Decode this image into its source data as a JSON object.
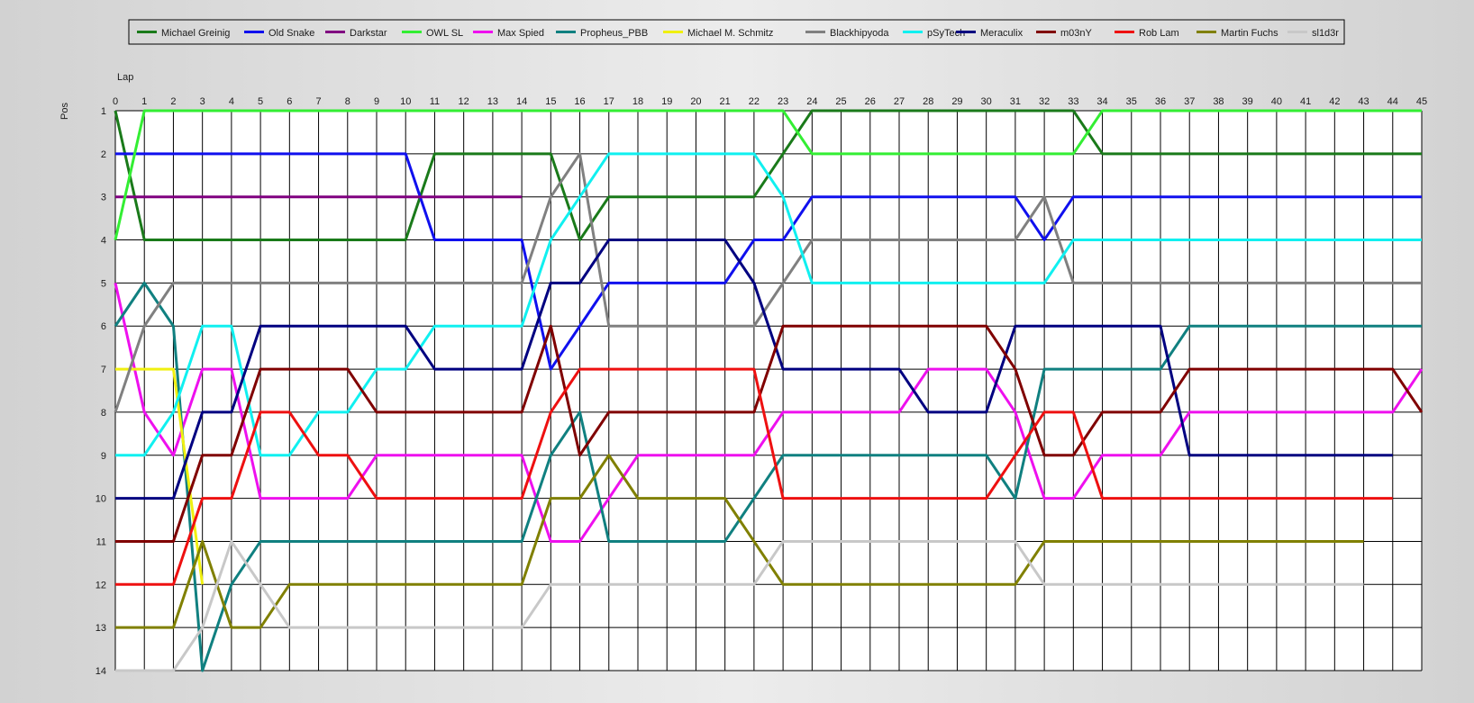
{
  "chart_data": {
    "type": "line",
    "xlabel": "Lap",
    "ylabel": "Pos",
    "xlim": [
      0,
      45
    ],
    "ylim": [
      1,
      14
    ],
    "y_inverted": true,
    "grid": true,
    "legend_position": "top",
    "x": [
      0,
      1,
      2,
      3,
      4,
      5,
      6,
      7,
      8,
      9,
      10,
      11,
      12,
      13,
      14,
      15,
      16,
      17,
      18,
      19,
      20,
      21,
      22,
      23,
      24,
      25,
      26,
      27,
      28,
      29,
      30,
      31,
      32,
      33,
      34,
      35,
      36,
      37,
      38,
      39,
      40,
      41,
      42,
      43,
      44,
      45
    ],
    "y_ticks": [
      1,
      2,
      3,
      4,
      5,
      6,
      7,
      8,
      9,
      10,
      11,
      12,
      13,
      14
    ],
    "series": [
      {
        "name": "Michael Greinig",
        "color": "#1a7a1a",
        "values": [
          1,
          4,
          4,
          4,
          4,
          4,
          4,
          4,
          4,
          4,
          4,
          2,
          2,
          2,
          2,
          2,
          4,
          3,
          3,
          3,
          3,
          3,
          3,
          2,
          1,
          1,
          1,
          1,
          1,
          1,
          1,
          1,
          1,
          1,
          2,
          2,
          2,
          2,
          2,
          2,
          2,
          2,
          2,
          2,
          2,
          2
        ]
      },
      {
        "name": "Old Snake",
        "color": "#1010ee",
        "values": [
          2,
          2,
          2,
          2,
          2,
          2,
          2,
          2,
          2,
          2,
          2,
          4,
          4,
          4,
          4,
          7,
          6,
          5,
          5,
          5,
          5,
          5,
          4,
          4,
          3,
          3,
          3,
          3,
          3,
          3,
          3,
          3,
          4,
          3,
          3,
          3,
          3,
          3,
          3,
          3,
          3,
          3,
          3,
          3,
          3,
          3
        ]
      },
      {
        "name": "Darkstar",
        "color": "#800080",
        "values": [
          3,
          3,
          3,
          3,
          3,
          3,
          3,
          3,
          3,
          3,
          3,
          3,
          3,
          3,
          3
        ]
      },
      {
        "name": "OWL SL",
        "color": "#33ee33",
        "values": [
          4,
          1,
          1,
          1,
          1,
          1,
          1,
          1,
          1,
          1,
          1,
          1,
          1,
          1,
          1,
          1,
          1,
          1,
          1,
          1,
          1,
          1,
          1,
          1,
          2,
          2,
          2,
          2,
          2,
          2,
          2,
          2,
          2,
          2,
          1,
          1,
          1,
          1,
          1,
          1,
          1,
          1,
          1,
          1,
          1,
          1
        ]
      },
      {
        "name": "Max Spied",
        "color": "#ee10ee",
        "values": [
          5,
          8,
          9,
          7,
          7,
          10,
          10,
          10,
          10,
          9,
          9,
          9,
          9,
          9,
          9,
          11,
          11,
          10,
          9,
          9,
          9,
          9,
          9,
          8,
          8,
          8,
          8,
          8,
          7,
          7,
          7,
          8,
          10,
          10,
          9,
          9,
          9,
          8,
          8,
          8,
          8,
          8,
          8,
          8,
          8,
          7
        ]
      },
      {
        "name": "Propheus_PBB",
        "color": "#108080",
        "values": [
          6,
          5,
          6,
          14,
          12,
          11,
          11,
          11,
          11,
          11,
          11,
          11,
          11,
          11,
          11,
          9,
          8,
          11,
          11,
          11,
          11,
          11,
          10,
          9,
          9,
          9,
          9,
          9,
          9,
          9,
          9,
          10,
          7,
          7,
          7,
          7,
          7,
          6,
          6,
          6,
          6,
          6,
          6,
          6,
          6,
          6
        ]
      },
      {
        "name": "Michael M. Schmitz",
        "color": "#f0f010",
        "values": [
          7,
          7,
          7,
          12
        ]
      },
      {
        "name": "Blackhipyoda",
        "color": "#808080",
        "values": [
          8,
          6,
          5,
          5,
          5,
          5,
          5,
          5,
          5,
          5,
          5,
          5,
          5,
          5,
          5,
          3,
          2,
          6,
          6,
          6,
          6,
          6,
          6,
          5,
          4,
          4,
          4,
          4,
          4,
          4,
          4,
          4,
          3,
          5,
          5,
          5,
          5,
          5,
          5,
          5,
          5,
          5,
          5,
          5,
          5,
          5
        ]
      },
      {
        "name": "pSyTech",
        "color": "#10f0f0",
        "values": [
          9,
          9,
          8,
          6,
          6,
          9,
          9,
          8,
          8,
          7,
          7,
          6,
          6,
          6,
          6,
          4,
          3,
          2,
          2,
          2,
          2,
          2,
          2,
          3,
          5,
          5,
          5,
          5,
          5,
          5,
          5,
          5,
          5,
          4,
          4,
          4,
          4,
          4,
          4,
          4,
          4,
          4,
          4,
          4,
          4,
          4
        ]
      },
      {
        "name": "Meraculix",
        "color": "#000080",
        "values": [
          10,
          10,
          10,
          8,
          8,
          6,
          6,
          6,
          6,
          6,
          6,
          7,
          7,
          7,
          7,
          5,
          5,
          4,
          4,
          4,
          4,
          4,
          5,
          7,
          7,
          7,
          7,
          7,
          8,
          8,
          8,
          6,
          6,
          6,
          6,
          6,
          6,
          9,
          9,
          9,
          9,
          9,
          9,
          9,
          9
        ]
      },
      {
        "name": "m03nY",
        "color": "#800000",
        "values": [
          11,
          11,
          11,
          9,
          9,
          7,
          7,
          7,
          7,
          8,
          8,
          8,
          8,
          8,
          8,
          6,
          9,
          8,
          8,
          8,
          8,
          8,
          8,
          6,
          6,
          6,
          6,
          6,
          6,
          6,
          6,
          7,
          9,
          9,
          8,
          8,
          8,
          7,
          7,
          7,
          7,
          7,
          7,
          7,
          7,
          8
        ]
      },
      {
        "name": "Rob Lam",
        "color": "#ee1010",
        "values": [
          12,
          12,
          12,
          10,
          10,
          8,
          8,
          9,
          9,
          10,
          10,
          10,
          10,
          10,
          10,
          8,
          7,
          7,
          7,
          7,
          7,
          7,
          7,
          10,
          10,
          10,
          10,
          10,
          10,
          10,
          10,
          9,
          8,
          8,
          10,
          10,
          10,
          10,
          10,
          10,
          10,
          10,
          10,
          10,
          10
        ]
      },
      {
        "name": "Martin Fuchs",
        "color": "#808000",
        "values": [
          13,
          13,
          13,
          11,
          13,
          13,
          12,
          12,
          12,
          12,
          12,
          12,
          12,
          12,
          12,
          10,
          10,
          9,
          10,
          10,
          10,
          10,
          11,
          12,
          12,
          12,
          12,
          12,
          12,
          12,
          12,
          12,
          11,
          11,
          11,
          11,
          11,
          11,
          11,
          11,
          11,
          11,
          11,
          11
        ]
      },
      {
        "name": "sl1d3r",
        "color": "#c8c8c8",
        "values": [
          14,
          14,
          14,
          13,
          11,
          12,
          13,
          13,
          13,
          13,
          13,
          13,
          13,
          13,
          13,
          12,
          12,
          12,
          12,
          12,
          12,
          12,
          12,
          11,
          11,
          11,
          11,
          11,
          11,
          11,
          11,
          11,
          12,
          12,
          12,
          12,
          12,
          12,
          12,
          12,
          12,
          12,
          12,
          12
        ]
      }
    ]
  }
}
